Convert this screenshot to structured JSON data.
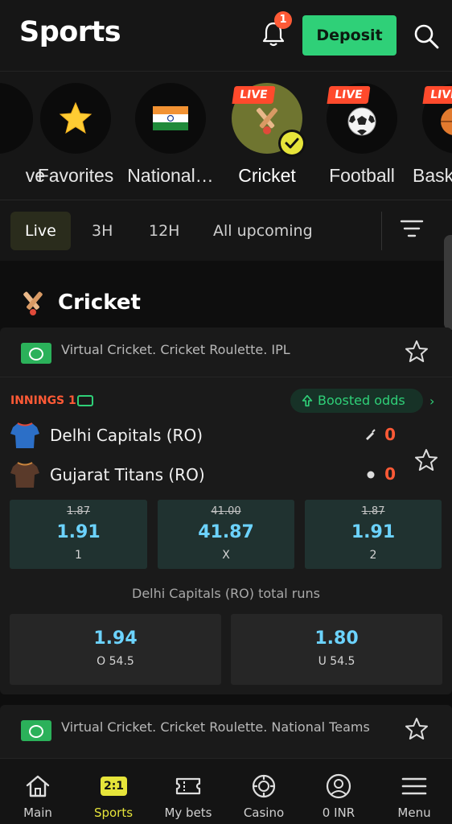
{
  "header": {
    "title": "Sports",
    "notification_count": "1",
    "deposit_label": "Deposit"
  },
  "sports_carousel": {
    "items": [
      {
        "label": "ve",
        "icon": "partial-icon",
        "live": false
      },
      {
        "label": "Favorites",
        "icon": "star-icon",
        "live": false
      },
      {
        "label": "National…",
        "icon": "india-flag-icon",
        "live": false
      },
      {
        "label": "Cricket",
        "icon": "cricket-icon",
        "live": true,
        "selected": true
      },
      {
        "label": "Football",
        "icon": "football-icon",
        "live": true
      },
      {
        "label": "Bask",
        "icon": "basketball-icon",
        "live": true
      }
    ],
    "live_label": "LIVE"
  },
  "time_filters": {
    "tabs": [
      "Live",
      "3H",
      "12H",
      "All upcoming"
    ],
    "active": "Live"
  },
  "section": {
    "title": "Cricket"
  },
  "events": [
    {
      "league": "Virtual Cricket. Cricket Roulette. IPL",
      "status": "INNINGS 1",
      "boosted_label": "Boosted odds",
      "team1": {
        "name": "Delhi Capitals (RO)",
        "score": "0"
      },
      "team2": {
        "name": "Gujarat Titans (RO)",
        "score": "0"
      },
      "odds": [
        {
          "old": "1.87",
          "value": "1.91",
          "label": "1"
        },
        {
          "old": "41.00",
          "value": "41.87",
          "label": "X"
        },
        {
          "old": "1.87",
          "value": "1.91",
          "label": "2"
        }
      ],
      "market_title": "Delhi Capitals (RO) total runs",
      "totals": [
        {
          "value": "1.94",
          "label": "O 54.5"
        },
        {
          "value": "1.80",
          "label": "U 54.5"
        }
      ]
    },
    {
      "league": "Virtual Cricket. Cricket Roulette. National Teams"
    }
  ],
  "bottom_nav": {
    "items": [
      "Main",
      "Sports",
      "My bets",
      "Casino",
      "0 INR",
      "Menu"
    ],
    "sports_badge": "2:1",
    "active": "Sports"
  },
  "colors": {
    "accent_green": "#2fd078",
    "live_red": "#ff5a36",
    "odds_blue": "#6cd3ff",
    "active_yellow": "#e6e43a"
  }
}
